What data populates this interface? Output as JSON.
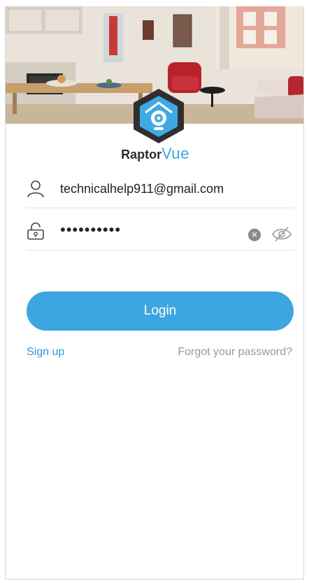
{
  "brand": {
    "part1": "Raptor",
    "part2": "Vue"
  },
  "login": {
    "email_value": "technicalhelp911@gmail.com",
    "password_value": "••••••••••",
    "button_label": "Login",
    "signup_label": "Sign up",
    "forgot_label": "Forgot your password?"
  },
  "colors": {
    "accent": "#3da5e0",
    "link": "#2b9ad8",
    "muted": "#9a9a9a"
  },
  "icons": [
    "user-icon",
    "lock-icon",
    "clear-icon",
    "eye-off-icon",
    "camera-logo-icon"
  ]
}
